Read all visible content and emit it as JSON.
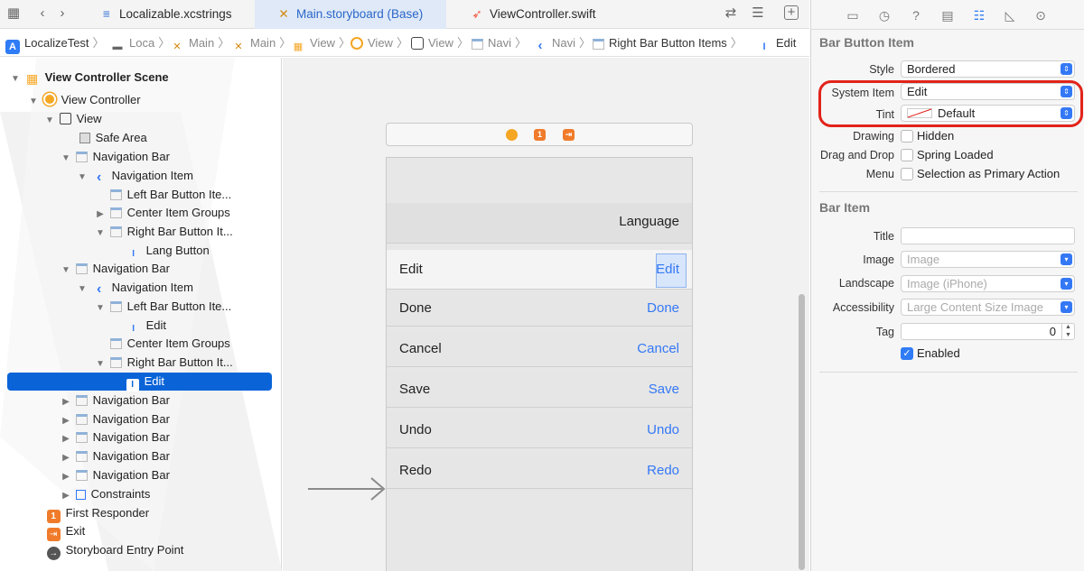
{
  "tabs": [
    {
      "label": "Localizable.xcstrings",
      "icon": "strings-file-icon"
    },
    {
      "label": "Main.storyboard (Base)",
      "icon": "storyboard-icon"
    },
    {
      "label": "ViewController.swift",
      "icon": "swift-file-icon"
    }
  ],
  "breadcrumbs": [
    {
      "label": "LocalizeTest"
    },
    {
      "label": "Loca"
    },
    {
      "label": "Main"
    },
    {
      "label": "Main"
    },
    {
      "label": "View"
    },
    {
      "label": "View"
    },
    {
      "label": "View"
    },
    {
      "label": "Navi"
    },
    {
      "label": "Navi"
    },
    {
      "label": "Right Bar Button Items"
    },
    {
      "label": "Edit"
    }
  ],
  "outline": {
    "scene": "View Controller Scene",
    "rows": [
      {
        "label": "View Controller"
      },
      {
        "label": "View"
      },
      {
        "label": "Safe Area"
      },
      {
        "label": "Navigation Bar"
      },
      {
        "label": "Navigation Item"
      },
      {
        "label": "Left Bar Button Ite..."
      },
      {
        "label": "Center Item Groups"
      },
      {
        "label": "Right Bar Button It..."
      },
      {
        "label": "Lang Button"
      },
      {
        "label": "Navigation Bar"
      },
      {
        "label": "Navigation Item"
      },
      {
        "label": "Left Bar Button Ite..."
      },
      {
        "label": "Edit"
      },
      {
        "label": "Center Item Groups"
      },
      {
        "label": "Right Bar Button It..."
      },
      {
        "label": "Edit"
      },
      {
        "label": "Navigation Bar"
      },
      {
        "label": "Navigation Bar"
      },
      {
        "label": "Navigation Bar"
      },
      {
        "label": "Navigation Bar"
      },
      {
        "label": "Navigation Bar"
      },
      {
        "label": "Constraints"
      },
      {
        "label": "First Responder"
      },
      {
        "label": "Exit"
      },
      {
        "label": "Storyboard Entry Point"
      }
    ]
  },
  "canvas": {
    "dock_badge": "1",
    "lang_title": "Language",
    "nav_rows": [
      {
        "title": "Edit",
        "button": "Edit"
      },
      {
        "title": "Done",
        "button": "Done"
      },
      {
        "title": "Cancel",
        "button": "Cancel"
      },
      {
        "title": "Save",
        "button": "Save"
      },
      {
        "title": "Undo",
        "button": "Undo"
      },
      {
        "title": "Redo",
        "button": "Redo"
      }
    ]
  },
  "inspector": {
    "bar_button_item": {
      "title": "Bar Button Item",
      "style_label": "Style",
      "style_value": "Bordered",
      "system_item_label": "System Item",
      "system_item_value": "Edit",
      "tint_label": "Tint",
      "tint_value": "Default",
      "drawing_label": "Drawing",
      "hidden_label": "Hidden",
      "drag_drop_label": "Drag and Drop",
      "spring_loaded_label": "Spring Loaded",
      "menu_label": "Menu",
      "primary_action_label": "Selection as Primary Action"
    },
    "bar_item": {
      "title": "Bar Item",
      "title_label": "Title",
      "title_value": "",
      "image_label": "Image",
      "image_placeholder": "Image",
      "landscape_label": "Landscape",
      "landscape_placeholder": "Image (iPhone)",
      "accessibility_label": "Accessibility",
      "accessibility_placeholder": "Large Content Size Image",
      "tag_label": "Tag",
      "tag_value": "0",
      "enabled_label": "Enabled"
    }
  },
  "colors": {
    "accent": "#3478f6",
    "selection": "#0a64d8",
    "highlight": "#e2231a",
    "storyboard_orange": "#f5a623"
  }
}
